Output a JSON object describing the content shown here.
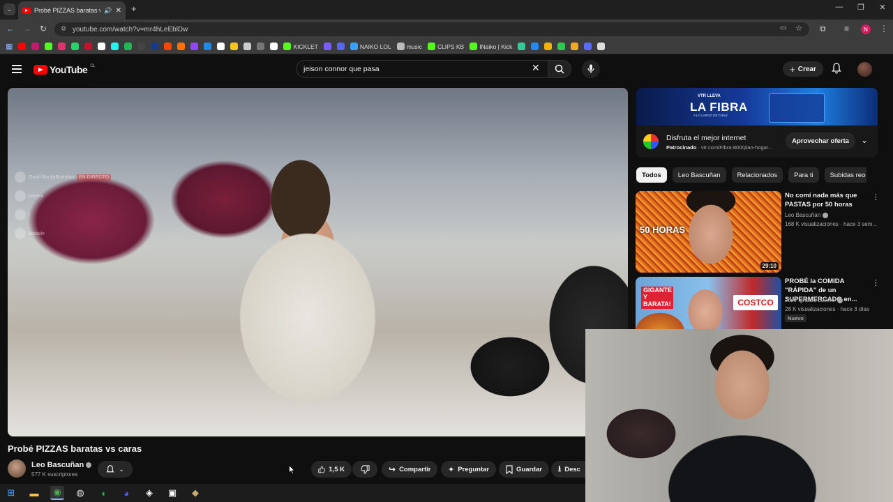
{
  "browser": {
    "tab_title": "Probé PIZZAS baratas vs caras",
    "url": "youtube.com/watch?v=mr4hLeEblDw",
    "profile_initial": "N",
    "bookmarks": [
      {
        "label": "",
        "color": "#ff0000"
      },
      {
        "label": "",
        "color": "#c21b6b"
      },
      {
        "label": "",
        "color": "#53fc18"
      },
      {
        "label": "",
        "color": "#e1306c"
      },
      {
        "label": "",
        "color": "#25d366"
      },
      {
        "label": "",
        "color": "#c8102e"
      },
      {
        "label": "",
        "color": "#ffffff"
      },
      {
        "label": "",
        "color": "#25f4ee"
      },
      {
        "label": "",
        "color": "#1db954"
      },
      {
        "label": "",
        "color": "#444444"
      },
      {
        "label": "",
        "color": "#1a3a8a"
      },
      {
        "label": "",
        "color": "#ff4500"
      },
      {
        "label": "",
        "color": "#ff6f00"
      },
      {
        "label": "",
        "color": "#9146ff"
      },
      {
        "label": "",
        "color": "#1e88e5"
      },
      {
        "label": "",
        "color": "#ffffff"
      },
      {
        "label": "",
        "color": "#f5c518"
      },
      {
        "label": "",
        "color": "#cccccc"
      },
      {
        "label": "",
        "color": "#777777"
      },
      {
        "label": "",
        "color": "#ffffff"
      },
      {
        "label": "KICKLET",
        "color": "#53fc18"
      },
      {
        "label": "",
        "color": "#7b5cff"
      },
      {
        "label": "",
        "color": "#5865f2"
      },
      {
        "label": "NAIKO LOL",
        "color": "#3aa0ff"
      },
      {
        "label": "music",
        "color": "#bbbbbb"
      },
      {
        "label": "CLIPS KB",
        "color": "#53fc18"
      },
      {
        "label": "INaiko | Kick",
        "color": "#53fc18"
      },
      {
        "label": "",
        "color": "#33cc99"
      },
      {
        "label": "",
        "color": "#2288ff"
      },
      {
        "label": "",
        "color": "#f0b400"
      },
      {
        "label": "",
        "color": "#32c850"
      },
      {
        "label": "",
        "color": "#f5a623"
      },
      {
        "label": "",
        "color": "#5a6bff"
      },
      {
        "label": "",
        "color": "#dddddd"
      }
    ]
  },
  "youtube": {
    "logo_text": "YouTube",
    "region": "CL",
    "search_query": "jeison connor que pasa",
    "create_label": "Crear"
  },
  "player": {
    "overlay_chat": [
      {
        "name": "Gordi RockyBrandon",
        "badge": "EN DIRECTO"
      },
      {
        "name": "barasa",
        "badge": ""
      },
      {
        "name": "l",
        "badge": ""
      },
      {
        "name": "Maaale",
        "badge": ""
      }
    ]
  },
  "video": {
    "title": "Probé PIZZAS baratas vs caras",
    "channel": "Leo Bascuñan",
    "subscribers": "577 K suscriptores",
    "likes": "1,5 K",
    "share_label": "Compartir",
    "ask_label": "Preguntar",
    "save_label": "Guardar",
    "download_label": "Desc"
  },
  "ad": {
    "banner_small": "VTR LLEVA",
    "banner_big": "LA FIBRA",
    "banner_sub": "A LO LARGO DE CHILE",
    "title": "Disfruta el mejor internet",
    "sponsor_label": "Patrocinado",
    "sponsor_url": "vtr.com/Fibra-800/plan-hogar...",
    "cta": "Aprovechar oferta"
  },
  "chips": [
    "Todos",
    "Leo Bascuñan",
    "Relacionados",
    "Para ti",
    "Subidas rec"
  ],
  "recommendations": [
    {
      "title": "No comí nada más que PASTAS por 50 horas",
      "thumb_label": "50 HORAS",
      "channel": "Leo Bascuñan",
      "meta": "168 K visualizaciones · hace 3 sem...",
      "duration": "29:10",
      "badge": ""
    },
    {
      "title": "PROBÉ la COMIDA \"RÁPIDA\" de un SUPERMERCADO en...",
      "thumb_label": "GIGANTE Y BARATA!",
      "thumb_brand": "COSTCO",
      "channel": "Jose Ignacio Lucero",
      "meta": "28 K visualizaciones · hace 3 días",
      "duration": "",
      "badge": "Nuevo"
    }
  ],
  "taskbar": [
    {
      "icon": "windows-start-icon",
      "color": "#4aa3ff"
    },
    {
      "icon": "file-explorer-icon",
      "color": "#f2c14e"
    },
    {
      "icon": "chrome-icon",
      "color": "#4caf50"
    },
    {
      "icon": "obs-icon",
      "color": "#dddddd"
    },
    {
      "icon": "spotify-icon",
      "color": "#1db954"
    },
    {
      "icon": "discord-icon",
      "color": "#5865f2"
    },
    {
      "icon": "streamlabs-icon",
      "color": "#ffffff"
    },
    {
      "icon": "epic-games-icon",
      "color": "#ffffff"
    },
    {
      "icon": "league-of-legends-icon",
      "color": "#c8aa6e"
    }
  ]
}
